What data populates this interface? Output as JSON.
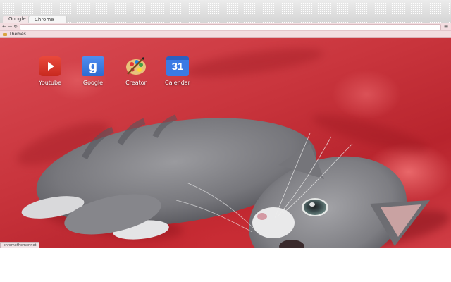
{
  "tabs": [
    {
      "label": "Google"
    },
    {
      "label": "Chrome"
    }
  ],
  "toolbar": {
    "back_icon": "←",
    "forward_icon": "→",
    "reload_icon": "↻",
    "menu_icon": "≡",
    "omnibox_value": ""
  },
  "bookmarks": {
    "items": [
      {
        "label": "Themes",
        "icon": "folder-icon"
      }
    ]
  },
  "apps": [
    {
      "label": "Youtube",
      "icon": "youtube-icon"
    },
    {
      "label": "Google",
      "icon": "google-icon",
      "glyph": "g"
    },
    {
      "label": "Creator",
      "icon": "palette-icon"
    },
    {
      "label": "Calendar",
      "icon": "calendar-icon",
      "glyph": "31"
    }
  ],
  "status": {
    "text": "chromethemer.net"
  },
  "colors": {
    "background": "#c9353d",
    "toolbar": "#f3dde0"
  }
}
